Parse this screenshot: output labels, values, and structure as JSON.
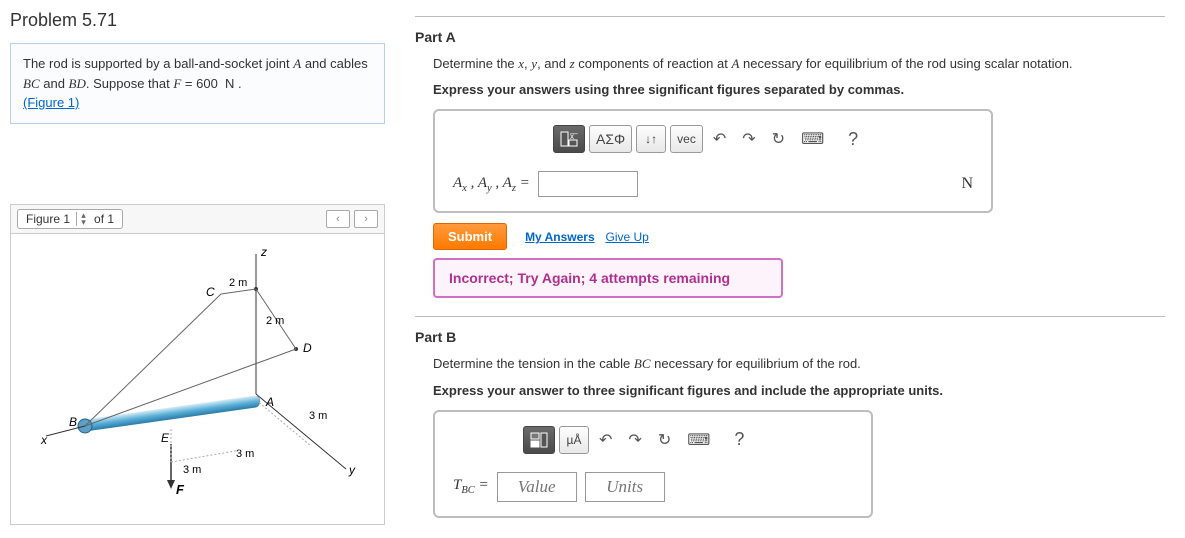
{
  "problem": {
    "title": "Problem 5.71",
    "prompt_html": "The rod is supported by a ball-and-socket joint A and cables BC and BD. Suppose that F = 600 N .",
    "figure_link": "(Figure 1)"
  },
  "figure": {
    "tab_label": "Figure 1",
    "of_text": "of 1",
    "dims": {
      "CD": "2 m",
      "DA": "2 m",
      "AY": "3 m",
      "EA": "3 m",
      "EF": "3 m"
    }
  },
  "partA": {
    "label": "Part A",
    "desc": "Determine the x, y, and z components of reaction at A necessary for equilibrium of the rod using scalar notation.",
    "instr": "Express your answers using three significant figures separated by commas.",
    "var_label": "Aₓ , Aᵧ , A_z =",
    "unit": "N",
    "submit": "Submit",
    "my_answers": "My Answers",
    "give_up": "Give Up",
    "feedback": "Incorrect; Try Again; 4 attempts remaining",
    "toolbar": {
      "greek": "ΑΣΦ",
      "arrows": "↓↑",
      "vec": "vec",
      "undo": "↶",
      "redo": "↷",
      "reset": "↻",
      "kb": "⌨",
      "help": "?"
    }
  },
  "partB": {
    "label": "Part B",
    "desc": "Determine the tension in the cable BC necessary for equilibrium of the rod.",
    "instr": "Express your answer to three significant figures and include the appropriate units.",
    "var_label": "T_BC =",
    "value_ph": "Value",
    "units_ph": "Units",
    "toolbar": {
      "units": "µÅ",
      "undo": "↶",
      "redo": "↷",
      "reset": "↻",
      "kb": "⌨",
      "help": "?"
    }
  }
}
